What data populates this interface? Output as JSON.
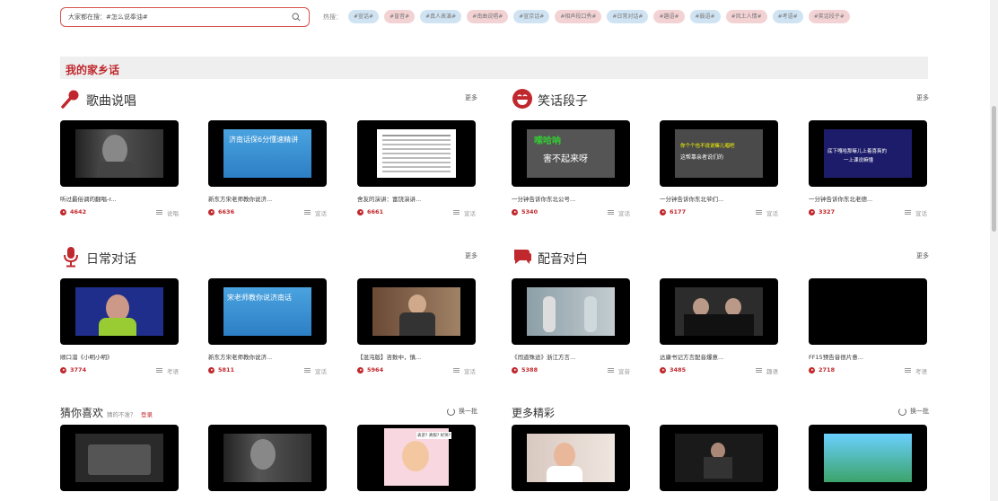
{
  "search": {
    "placeholder": "大家都在搜：#怎么说奉油#"
  },
  "hot": {
    "label": "热搜：",
    "tags": [
      {
        "text": "#宣话#",
        "color": "blue"
      },
      {
        "text": "#盲音#",
        "color": "pink"
      },
      {
        "text": "#真人表演#",
        "color": "blue"
      },
      {
        "text": "#南曲说唱#",
        "color": "pink"
      },
      {
        "text": "#宣京话#",
        "color": "blue"
      },
      {
        "text": "#相声段口秀#",
        "color": "pink"
      },
      {
        "text": "#日常对话#",
        "color": "blue"
      },
      {
        "text": "#趣语#",
        "color": "pink"
      },
      {
        "text": "#鼓语#",
        "color": "blue"
      },
      {
        "text": "#风土人情#",
        "color": "pink"
      },
      {
        "text": "#考语#",
        "color": "blue"
      },
      {
        "text": "#笑话段子#",
        "color": "pink"
      }
    ]
  },
  "hometown": {
    "title": "我的家乡话"
  },
  "sections": {
    "songs": {
      "title": "歌曲说唱",
      "more": "更多",
      "cards": [
        {
          "title": "听过最俗调的翻唱-r...",
          "count": "4642",
          "cat": "说唱"
        },
        {
          "title": "新东方宋老师教你说济...",
          "count": "6636",
          "cat": "宣话"
        },
        {
          "title": "舍友的演讲：富饶演讲...",
          "count": "6661",
          "cat": "宣话"
        }
      ]
    },
    "jokes": {
      "title": "笑话段子",
      "more": "更多",
      "cards": [
        {
          "title": "一分钟告诉你东北公号...",
          "count": "5340",
          "cat": "宣话"
        },
        {
          "title": "一分钟告诉你东北爷们...",
          "count": "6177",
          "cat": "宣话"
        },
        {
          "title": "一分钟告诉你东北老德...",
          "count": "3327",
          "cat": "宣话"
        }
      ]
    },
    "daily": {
      "title": "日常对话",
      "more": "更多",
      "cards": [
        {
          "title": "顺口溜《小明小明》",
          "count": "3774",
          "cat": "考语"
        },
        {
          "title": "新东方宋老师教你说济...",
          "count": "5811",
          "cat": "宣话"
        },
        {
          "title": "【混沌版】咨数中，慎...",
          "count": "5964",
          "cat": "宣话"
        }
      ]
    },
    "dubbing": {
      "title": "配音对白",
      "more": "更多",
      "cards": [
        {
          "title": "《闯道殊途》浙江方言...",
          "count": "5388",
          "cat": "宣音"
        },
        {
          "title": "达康书记方言配音爆意...",
          "count": "3485",
          "cat": "趣语"
        },
        {
          "title": "FF15预告音很片意...",
          "count": "2718",
          "cat": "考语"
        }
      ]
    },
    "guess": {
      "title": "猜你喜欢",
      "sub": "猜的不准？",
      "login": "登录",
      "refresh": "换一批"
    },
    "more_wonderful": {
      "title": "更多精彩",
      "refresh": "换一批"
    }
  },
  "thumb_text": {
    "songs_2": "济南话保6分懂速精讲",
    "jokes_1a": "嗦哈呐",
    "jokes_1b": "害不起来呀",
    "jokes_2a": "你个个也不说说嘛儿唱吧",
    "jokes_2b": "这帮靠亲者说们的",
    "jokes_3a": "底下嘎哈那嘛儿上着喜爽的",
    "jokes_3b": "一上课说嘛懂",
    "daily_2a": "宋老师教你说济南话",
    "guess_3": "表弟? 真假? 好哭?"
  },
  "colors": {
    "accent": "#c0282d",
    "tag_blue": "#cfe3f3",
    "tag_pink": "#f3d2d4"
  }
}
